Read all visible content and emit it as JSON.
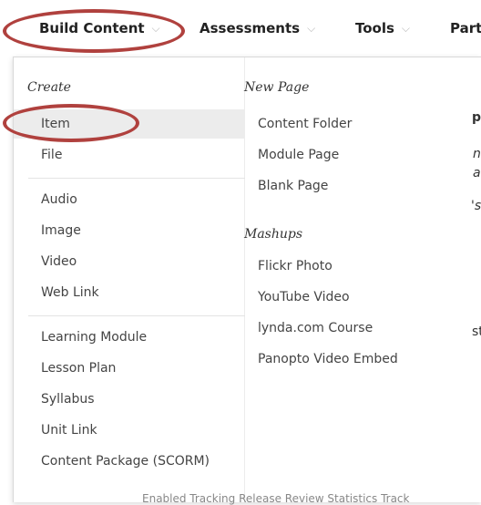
{
  "toolbar": {
    "build_content": "Build Content",
    "assessments": "Assessments",
    "tools": "Tools",
    "partial": "Part",
    "chevron": "⌵"
  },
  "menu": {
    "create_heading": "Create",
    "create_items": [
      "Item",
      "File",
      "Audio",
      "Image",
      "Video",
      "Web Link",
      "Learning Module",
      "Lesson Plan",
      "Syllabus",
      "Unit Link",
      "Content Package (SCORM)"
    ],
    "new_page_heading": "New Page",
    "new_page_items": [
      "Content Folder",
      "Module Page",
      "Blank Page"
    ],
    "mashups_heading": "Mashups",
    "mashups_items": [
      "Flickr Photo",
      "YouTube Video",
      "lynda.com Course",
      "Panopto Video Embed"
    ]
  },
  "annotation": {
    "color": "#b0413e"
  },
  "background": {
    "fragments": [
      "p",
      "n",
      "a",
      "'s",
      "st"
    ],
    "bottom_partial": "Enabled   Tracking Release  Review  Statistics Track"
  }
}
